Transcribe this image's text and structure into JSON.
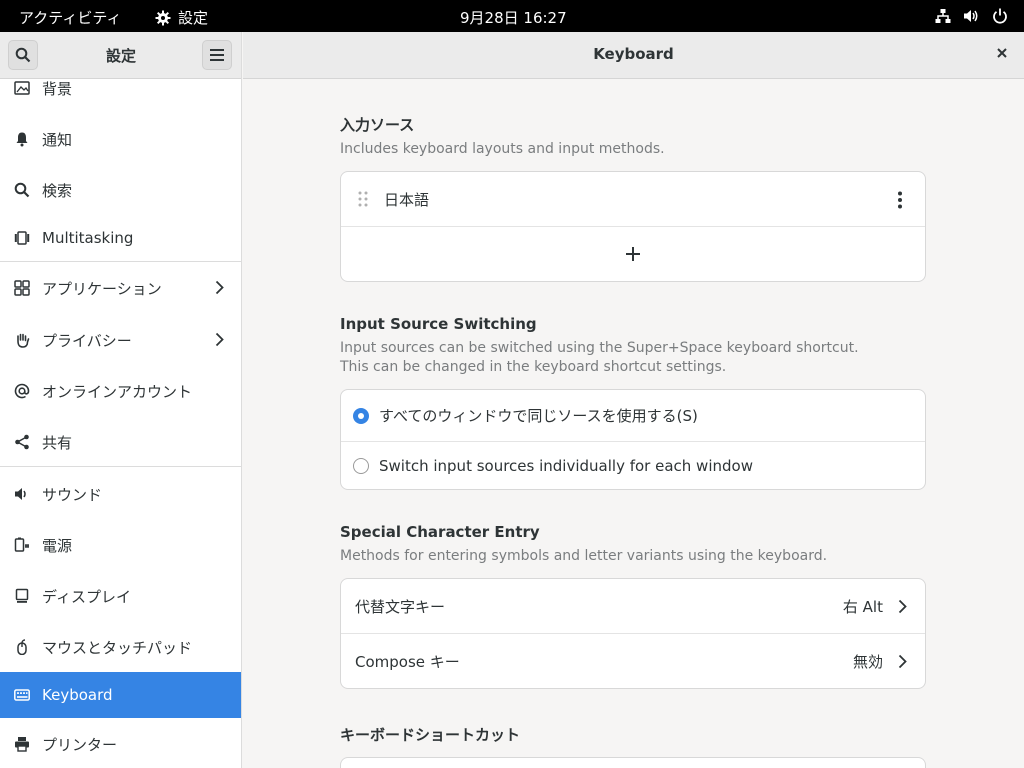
{
  "topbar": {
    "activities": "アクティビティ",
    "app_name": "設定",
    "clock": "9月28日 16:27"
  },
  "sidebar": {
    "title": "設定",
    "items": [
      {
        "label": "背景",
        "icon": "background-icon"
      },
      {
        "label": "通知",
        "icon": "bell-icon"
      },
      {
        "label": "検索",
        "icon": "search-icon"
      },
      {
        "label": "Multitasking",
        "icon": "multitasking-icon"
      },
      {
        "label": "アプリケーション",
        "icon": "apps-grid-icon"
      },
      {
        "label": "プライバシー",
        "icon": "hand-icon"
      },
      {
        "label": "オンラインアカウント",
        "icon": "at-icon"
      },
      {
        "label": "共有",
        "icon": "share-icon"
      },
      {
        "label": "サウンド",
        "icon": "speaker-icon"
      },
      {
        "label": "電源",
        "icon": "power-plug-icon"
      },
      {
        "label": "ディスプレイ",
        "icon": "display-icon"
      },
      {
        "label": "マウスとタッチパッド",
        "icon": "mouse-icon"
      },
      {
        "label": "Keyboard",
        "icon": "keyboard-icon"
      },
      {
        "label": "プリンター",
        "icon": "printer-icon"
      }
    ]
  },
  "main": {
    "title": "Keyboard",
    "input_sources": {
      "title": "入力ソース",
      "desc": "Includes keyboard layouts and input methods.",
      "source": "日本語"
    },
    "switching": {
      "title": "Input Source Switching",
      "desc1": "Input sources can be switched using the Super+Space keyboard shortcut.",
      "desc2": "This can be changed in the keyboard shortcut settings.",
      "option_same": "すべてのウィンドウで同じソースを使用する(S)",
      "option_individual": "Switch input sources individually for each window"
    },
    "special": {
      "title": "Special Character Entry",
      "desc": "Methods for entering symbols and letter variants using the keyboard.",
      "alt_label": "代替文字キー",
      "alt_value": "右 Alt",
      "compose_label": "Compose キー",
      "compose_value": "無効"
    },
    "shortcuts": {
      "title": "キーボードショートカット"
    }
  },
  "colors": {
    "accent": "#3584e4",
    "topbar": "#000000"
  }
}
